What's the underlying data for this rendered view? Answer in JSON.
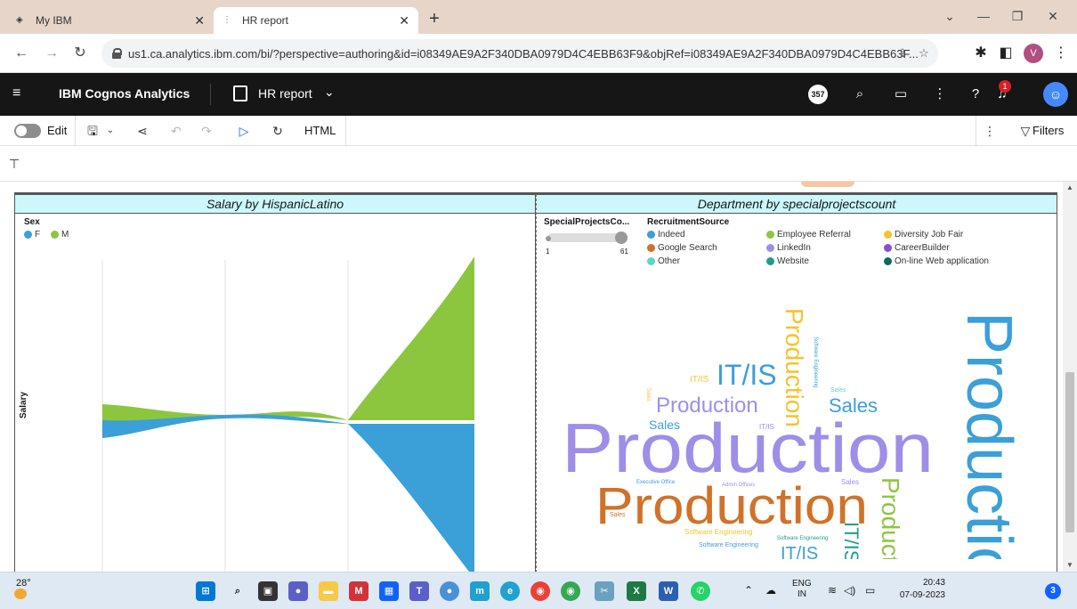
{
  "browser": {
    "tabs": [
      {
        "title": "My IBM"
      },
      {
        "title": "HR report"
      }
    ],
    "new_tab": "+",
    "url": "us1.ca.analytics.ibm.com/bi/?perspective=authoring&id=i08349AE9A2F340DBA0979D4C4EBB63F9&objRef=i08349AE9A2F340DBA0979D4C4EBB63F...",
    "profile_initial": "V"
  },
  "app": {
    "brand": "IBM Cognos Analytics",
    "report_title": "HR report",
    "notification_badge": "357",
    "bell_count": "1"
  },
  "toolbar": {
    "edit_label": "Edit",
    "html_label": "HTML",
    "filters_label": "Filters"
  },
  "left_chart": {
    "title": "Salary by HispanicLatino",
    "legend_title": "Sex",
    "legend": [
      {
        "label": "F",
        "color": "#3b9fd8"
      },
      {
        "label": "M",
        "color": "#8cc63f"
      }
    ],
    "y_axis_label": "Salary"
  },
  "right_chart": {
    "title": "Department by specialprojectscount",
    "slider": {
      "title": "SpecialProjectsCo...",
      "min": "1",
      "max": "61"
    },
    "legend_title": "RecruitmentSource",
    "legend": [
      {
        "label": "Indeed",
        "color": "#3b9fd8"
      },
      {
        "label": "Employee Referral",
        "color": "#8cc63f"
      },
      {
        "label": "Diversity Job Fair",
        "color": "#f2c42d"
      },
      {
        "label": "Google Search",
        "color": "#d07229"
      },
      {
        "label": "LinkedIn",
        "color": "#9e8ee8"
      },
      {
        "label": "CareerBuilder",
        "color": "#8a4fd0"
      },
      {
        "label": "Other",
        "color": "#5ed6c4"
      },
      {
        "label": "Website",
        "color": "#1e9c8c"
      },
      {
        "label": "On-line Web application",
        "color": "#0f6a5a"
      }
    ],
    "words": {
      "itis_big": "IT/IS",
      "itis_small": "IT/IS",
      "production_mid": "Production",
      "sales_right": "Sales",
      "sales_left": "Sales",
      "production_big": "Production",
      "production_orange": "Production",
      "production_vertical_yellow": "Production",
      "production_vertical_blue": "Productio",
      "production_vertical_green": "Productio",
      "itis_vertical_green": "IT/IS",
      "itis_bottom": "IT/IS",
      "software_eng_yellow": "Software Engineering",
      "software_eng_blue": "Software Engineering",
      "software_eng_small": "Software Engineering",
      "sales_tiny": "Sales",
      "itis_tiny": "IT/IS",
      "exec_office": "Executive Office",
      "admin_offices": "Admin Offices",
      "sales_orange_tiny": "Sales",
      "sales_vertical_tiny": "Sales",
      "sales_small_right": "Sales",
      "software_vertical": "Software Engineering"
    }
  },
  "taskbar": {
    "temperature": "28°",
    "lang_top": "ENG",
    "lang_bottom": "IN",
    "time": "20:43",
    "date": "07-09-2023",
    "notif_count": "3"
  }
}
